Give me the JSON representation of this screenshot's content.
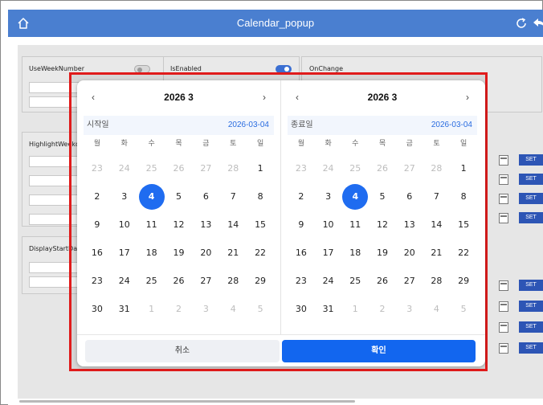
{
  "app": {
    "title": "Calendar_popup"
  },
  "background": {
    "panels": [
      {
        "label": "UseWeekNumber"
      },
      {
        "label": "IsEnabled"
      },
      {
        "label": "OnChange"
      },
      {
        "label": "HighlightWeekd"
      },
      {
        "label": "DisplayStartDa"
      }
    ],
    "set_label": "SET"
  },
  "popup": {
    "calendars": [
      {
        "month_title": "2026 3",
        "date_label": "시작일",
        "date_value": "2026-03-04",
        "weekdays": [
          "월",
          "화",
          "수",
          "목",
          "금",
          "토",
          "일"
        ],
        "days": [
          {
            "d": "23",
            "m": true
          },
          {
            "d": "24",
            "m": true
          },
          {
            "d": "25",
            "m": true
          },
          {
            "d": "26",
            "m": true
          },
          {
            "d": "27",
            "m": true
          },
          {
            "d": "28",
            "m": true
          },
          {
            "d": "1"
          },
          {
            "d": "2"
          },
          {
            "d": "3"
          },
          {
            "d": "4",
            "s": true
          },
          {
            "d": "5"
          },
          {
            "d": "6"
          },
          {
            "d": "7"
          },
          {
            "d": "8"
          },
          {
            "d": "9"
          },
          {
            "d": "10"
          },
          {
            "d": "11"
          },
          {
            "d": "12"
          },
          {
            "d": "13"
          },
          {
            "d": "14"
          },
          {
            "d": "15"
          },
          {
            "d": "16"
          },
          {
            "d": "17"
          },
          {
            "d": "18"
          },
          {
            "d": "19"
          },
          {
            "d": "20"
          },
          {
            "d": "21"
          },
          {
            "d": "22"
          },
          {
            "d": "23"
          },
          {
            "d": "24"
          },
          {
            "d": "25"
          },
          {
            "d": "26"
          },
          {
            "d": "27"
          },
          {
            "d": "28"
          },
          {
            "d": "29"
          },
          {
            "d": "30"
          },
          {
            "d": "31"
          },
          {
            "d": "1",
            "m": true
          },
          {
            "d": "2",
            "m": true
          },
          {
            "d": "3",
            "m": true
          },
          {
            "d": "4",
            "m": true
          },
          {
            "d": "5",
            "m": true
          }
        ]
      },
      {
        "month_title": "2026 3",
        "date_label": "종료일",
        "date_value": "2026-03-04",
        "weekdays": [
          "월",
          "화",
          "수",
          "목",
          "금",
          "토",
          "일"
        ],
        "days": [
          {
            "d": "23",
            "m": true
          },
          {
            "d": "24",
            "m": true
          },
          {
            "d": "25",
            "m": true
          },
          {
            "d": "26",
            "m": true
          },
          {
            "d": "27",
            "m": true
          },
          {
            "d": "28",
            "m": true
          },
          {
            "d": "1"
          },
          {
            "d": "2"
          },
          {
            "d": "3"
          },
          {
            "d": "4",
            "s": true
          },
          {
            "d": "5"
          },
          {
            "d": "6"
          },
          {
            "d": "7"
          },
          {
            "d": "8"
          },
          {
            "d": "9"
          },
          {
            "d": "10"
          },
          {
            "d": "11"
          },
          {
            "d": "12"
          },
          {
            "d": "13"
          },
          {
            "d": "14"
          },
          {
            "d": "15"
          },
          {
            "d": "16"
          },
          {
            "d": "17"
          },
          {
            "d": "18"
          },
          {
            "d": "19"
          },
          {
            "d": "20"
          },
          {
            "d": "21"
          },
          {
            "d": "22"
          },
          {
            "d": "23"
          },
          {
            "d": "24"
          },
          {
            "d": "25"
          },
          {
            "d": "26"
          },
          {
            "d": "27"
          },
          {
            "d": "28"
          },
          {
            "d": "29"
          },
          {
            "d": "30"
          },
          {
            "d": "31"
          },
          {
            "d": "1",
            "m": true
          },
          {
            "d": "2",
            "m": true
          },
          {
            "d": "3",
            "m": true
          },
          {
            "d": "4",
            "m": true
          },
          {
            "d": "5",
            "m": true
          }
        ]
      }
    ],
    "cancel_label": "취소",
    "confirm_label": "확인",
    "prev_glyph": "‹",
    "next_glyph": "›"
  },
  "colors": {
    "titlebar": "#4a7fd0",
    "accent": "#1f6cf0",
    "highlight_border": "#e01b1b"
  }
}
